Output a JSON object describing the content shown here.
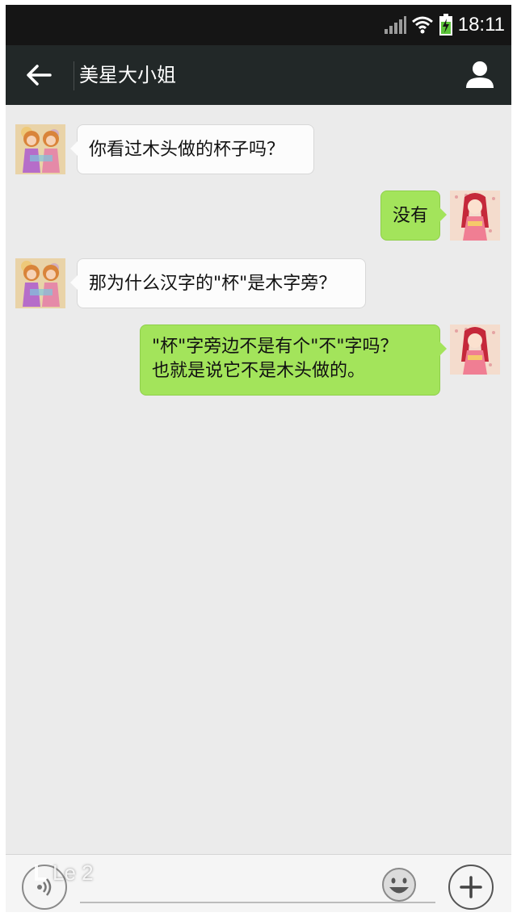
{
  "status_bar": {
    "time": "18:11",
    "icons": [
      "signal-icon",
      "wifi-icon",
      "battery-charging-icon"
    ]
  },
  "header": {
    "title": "美星大小姐",
    "back_icon": "arrow-left-icon",
    "profile_icon": "person-icon"
  },
  "messages": [
    {
      "from": "contact",
      "lines": [
        "你看过木头做的杯子吗？"
      ]
    },
    {
      "from": "me",
      "lines": [
        "没有"
      ]
    },
    {
      "from": "contact",
      "lines": [
        "那为什么汉字的\"杯\"是木字旁？"
      ]
    },
    {
      "from": "me",
      "lines": [
        "\"杯\"字旁边不是有个\"不\"字吗？",
        "也就是说它不是木头做的。"
      ]
    }
  ],
  "input_bar": {
    "value": "",
    "icons": [
      "voice-icon",
      "emoji-icon",
      "plus-icon"
    ]
  },
  "watermark": "Le 2",
  "colors": {
    "header_bg": "#222828",
    "chat_bg": "#ebebeb",
    "outgoing_bubble": "#a3e45b",
    "incoming_bubble": "#fcfcfc"
  }
}
